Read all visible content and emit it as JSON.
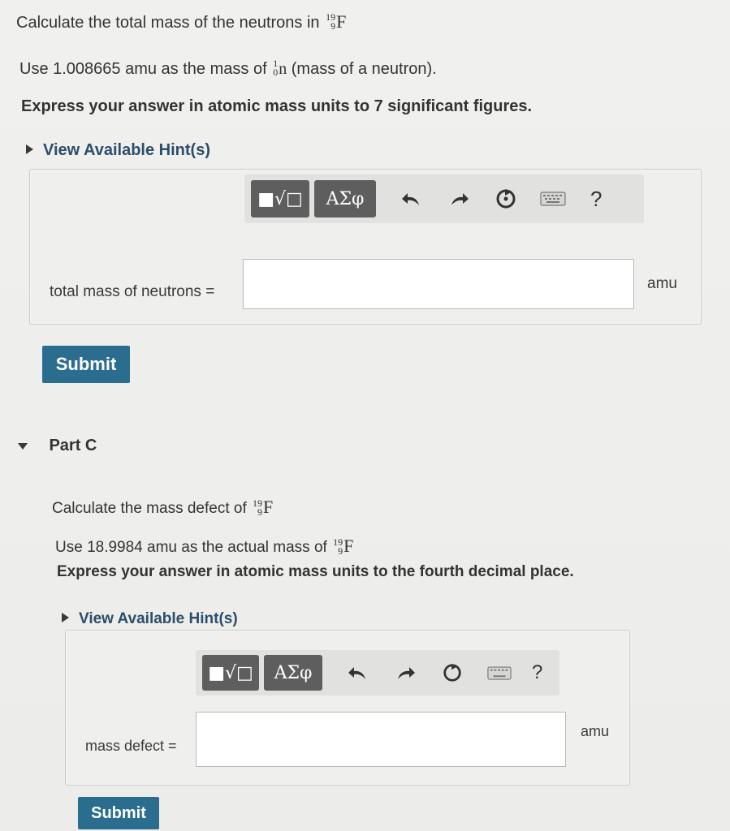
{
  "part_b": {
    "q1_prefix": "Calculate the total mass of the neutrons in",
    "nuclide_mass": "19",
    "nuclide_atomic": "9",
    "nuclide_symbol": "F",
    "q2_prefix": "Use 1.008665 amu as the mass of",
    "neutron_mass_number": "1",
    "neutron_atomic": "0",
    "neutron_symbol": "n",
    "q2_suffix": "(mass of a neutron).",
    "q3": "Express your answer in atomic mass units to 7 significant figures.",
    "hint": "View Available Hint(s)",
    "toolbar": {
      "templates": "■√□",
      "greek": "ΑΣφ",
      "help": "?"
    },
    "input_label": "total mass of neutrons =",
    "input_value": "",
    "unit": "amu",
    "submit": "Submit"
  },
  "part_c": {
    "title": "Part C",
    "q1_prefix": "Calculate the mass defect of",
    "nuclide_mass": "19",
    "nuclide_atomic": "9",
    "nuclide_symbol": "F",
    "q2_prefix": "Use 18.9984 amu as the actual mass of",
    "q3": "Express your answer in atomic mass units to the fourth decimal place.",
    "hint": "View Available Hint(s)",
    "toolbar": {
      "templates": "■√□",
      "greek": "ΑΣφ",
      "help": "?"
    },
    "input_label": "mass defect =",
    "input_value": "",
    "unit": "amu",
    "submit": "Submit"
  },
  "colors": {
    "submit": "#2b6d8f",
    "hint_link": "#2b4f6a",
    "toolbar_button": "#5e5e5e"
  },
  "icons": [
    "templates-icon",
    "greek-icon",
    "undo-icon",
    "redo-icon",
    "reset-icon",
    "keyboard-icon",
    "help-icon",
    "expand-triangle-icon",
    "collapse-triangle-icon"
  ]
}
